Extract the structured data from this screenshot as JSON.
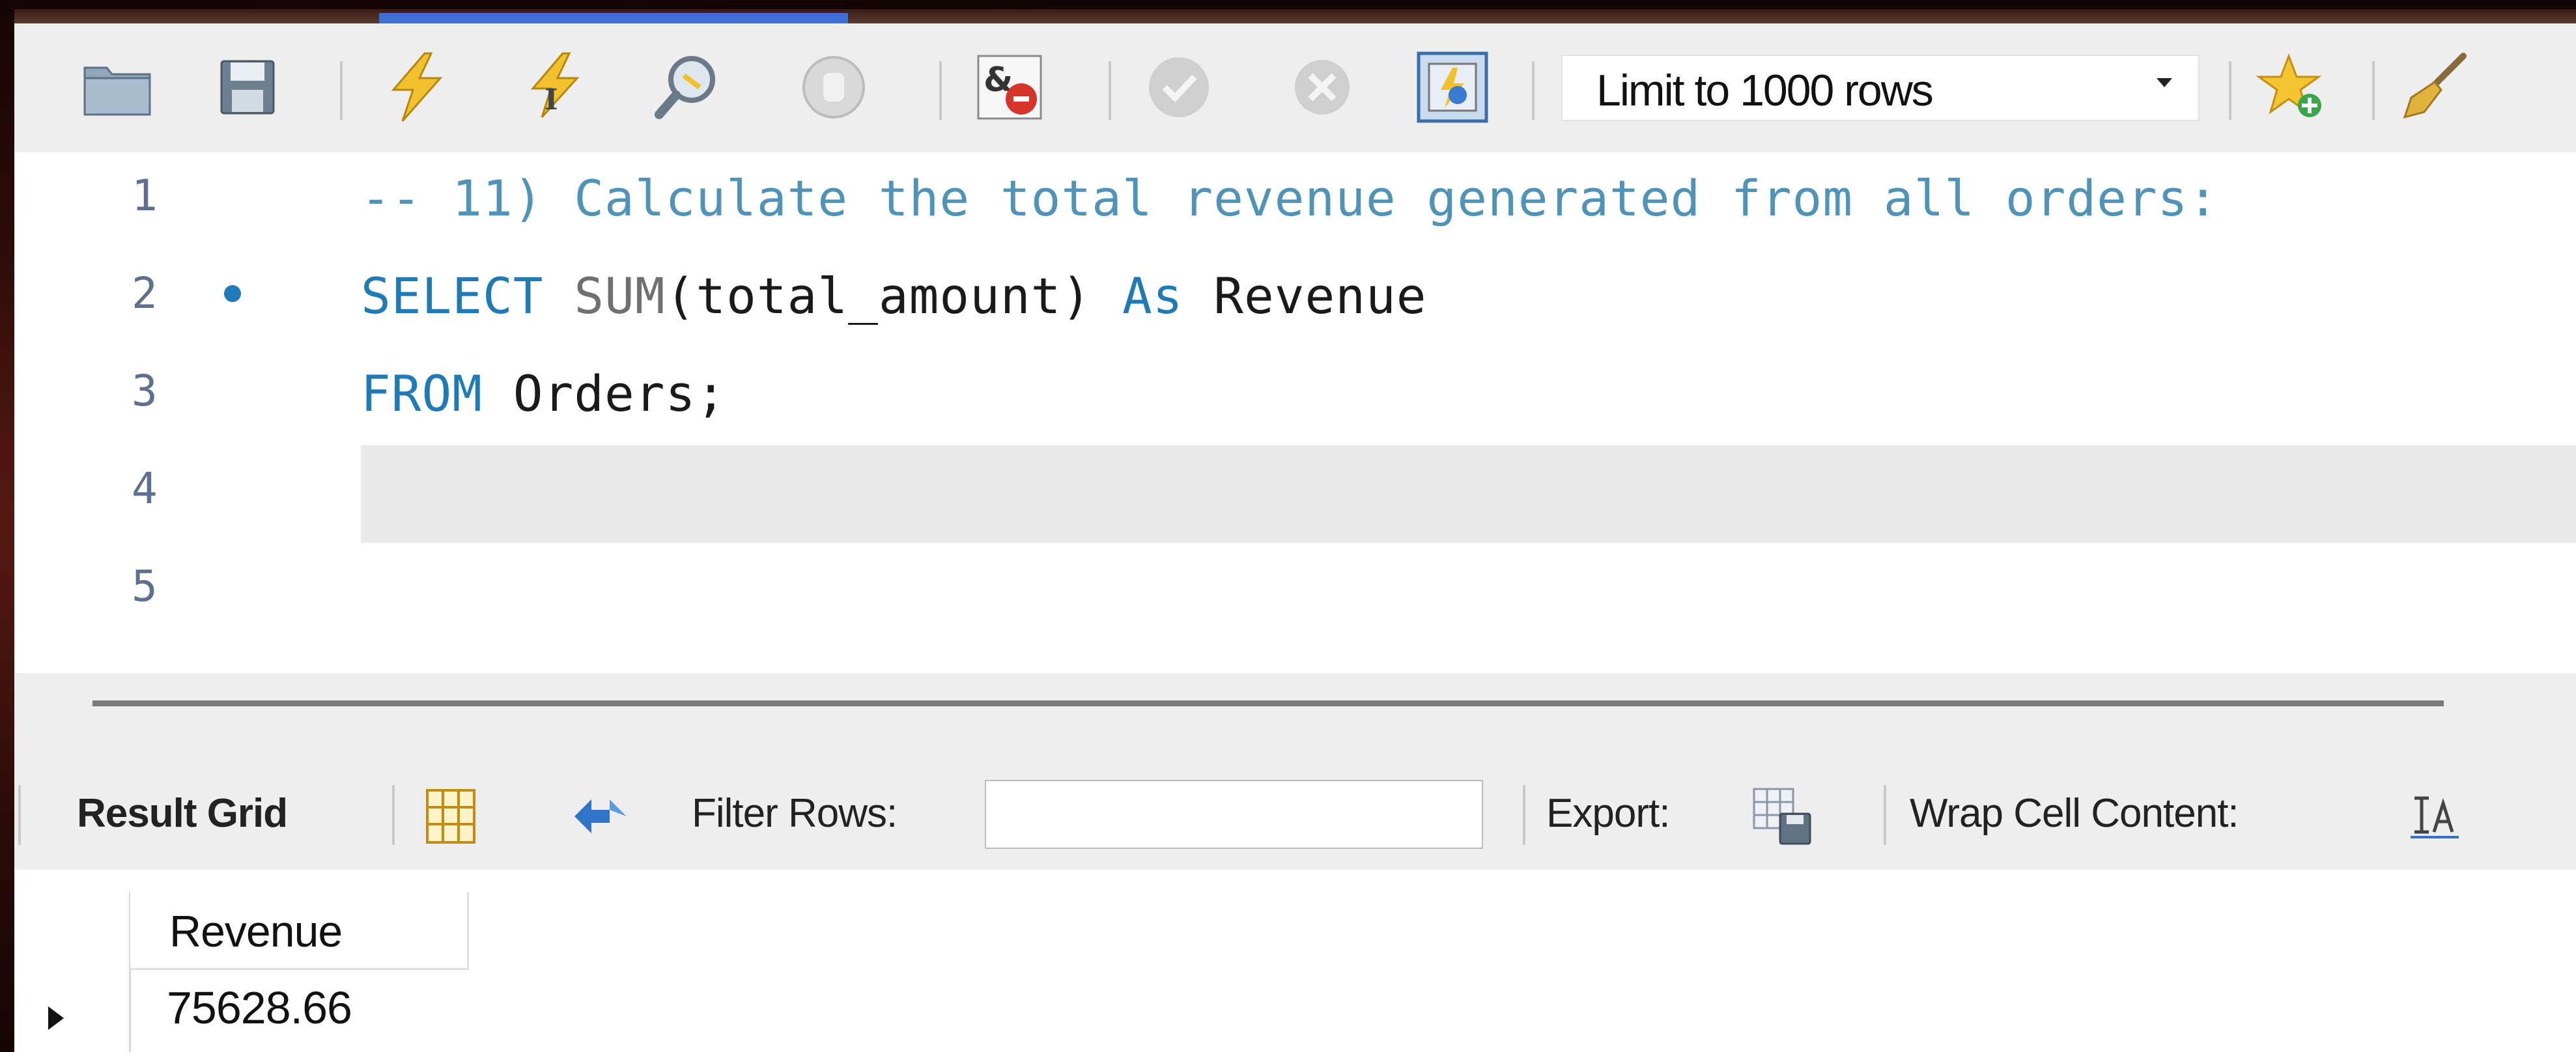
{
  "toolbar": {
    "limit_select": {
      "value": "Limit to 1000 rows"
    },
    "icons": [
      "open-folder-icon",
      "save-icon",
      "execute-icon",
      "execute-current-icon",
      "explain-icon",
      "stop-icon",
      "toggle-error-stop-icon",
      "commit-icon",
      "rollback-icon",
      "autocommit-icon",
      "add-snippet-icon",
      "beautify-icon"
    ]
  },
  "editor": {
    "lines": [
      {
        "number": "1",
        "tokens": [
          {
            "t": "-- 11) Calculate the total revenue generated from all orders:",
            "c": "cm"
          }
        ]
      },
      {
        "number": "2",
        "tokens": [
          {
            "t": "SELECT",
            "c": "kw"
          },
          {
            "t": " ",
            "c": ""
          },
          {
            "t": "SUM",
            "c": "fn"
          },
          {
            "t": "(total_amount) ",
            "c": ""
          },
          {
            "t": "As",
            "c": "kw"
          },
          {
            "t": " Revenue",
            "c": ""
          }
        ]
      },
      {
        "number": "3",
        "tokens": [
          {
            "t": "FROM",
            "c": "kw"
          },
          {
            "t": " Orders;",
            "c": ""
          }
        ]
      },
      {
        "number": "4",
        "tokens": []
      },
      {
        "number": "5",
        "tokens": []
      }
    ]
  },
  "result_toolbar": {
    "result_grid_label": "Result Grid",
    "filter_label": "Filter Rows:",
    "filter_value": "",
    "export_label": "Export:",
    "wrap_label": "Wrap Cell Content:"
  },
  "grid": {
    "columns": [
      "Revenue"
    ],
    "rows": [
      [
        "75628.66"
      ]
    ]
  },
  "colors": {
    "keyword": "#1f7ab8",
    "comment": "#4f93b8",
    "function": "#707070",
    "breakpoint_dot": "#1f7ab8"
  }
}
